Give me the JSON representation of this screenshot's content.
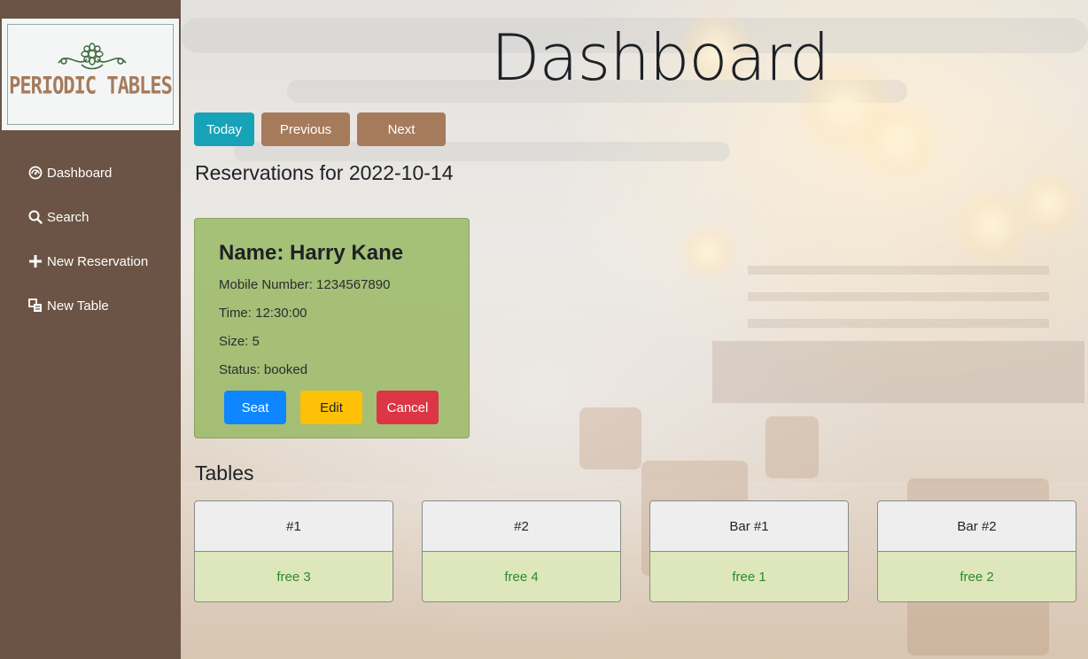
{
  "logo": {
    "text": "PERIODIC TABLES"
  },
  "sidebar": {
    "items": [
      {
        "label": "Dashboard",
        "icon": "dashboard-icon"
      },
      {
        "label": "Search",
        "icon": "search-icon"
      },
      {
        "label": "New Reservation",
        "icon": "plus-icon"
      },
      {
        "label": "New Table",
        "icon": "table-icon"
      }
    ]
  },
  "header": {
    "title": "Dashboard"
  },
  "date_nav": {
    "today": "Today",
    "previous": "Previous",
    "next": "Next"
  },
  "reservations": {
    "heading": "Reservations for 2022-10-14",
    "items": [
      {
        "name": "Name: Harry Kane",
        "mobile": "Mobile Number: 1234567890",
        "time": "Time: 12:30:00",
        "size": "Size: 5",
        "status": "Status: booked",
        "seat_label": "Seat",
        "edit_label": "Edit",
        "cancel_label": "Cancel"
      }
    ]
  },
  "tables": {
    "heading": "Tables",
    "items": [
      {
        "name": "#1",
        "status": "free 3"
      },
      {
        "name": "#2",
        "status": "free 4"
      },
      {
        "name": "Bar #1",
        "status": "free 1"
      },
      {
        "name": "Bar #2",
        "status": "free 2"
      }
    ]
  },
  "colors": {
    "sidebar": "#6b5445",
    "accent_brown": "#a57b5c",
    "today_button": "#17a2b8",
    "card_green": "#9bba68",
    "seat_button": "#0d86ff",
    "edit_button": "#ffc107",
    "cancel_button": "#dc3545"
  }
}
